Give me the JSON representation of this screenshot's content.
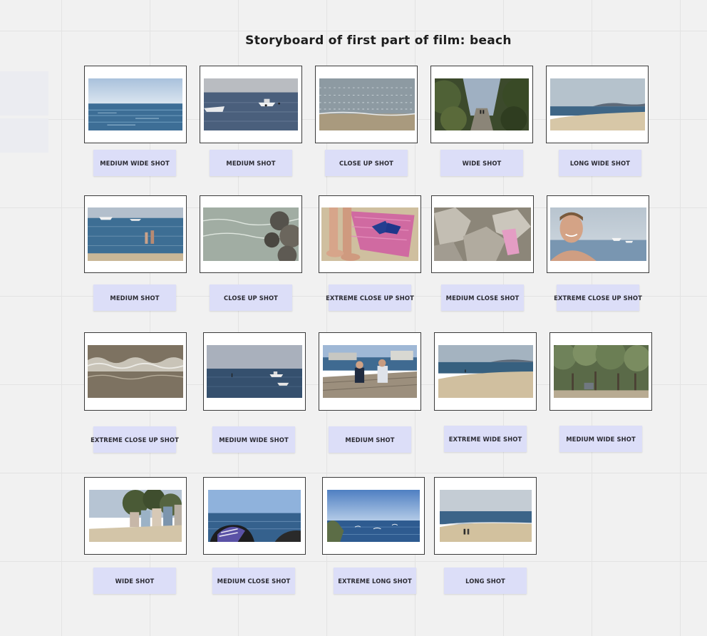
{
  "board": {
    "title": "Storyboard of first part of film: beach"
  },
  "shots": [
    {
      "label": "MEDIUM WIDE SHOT",
      "scene": "open-sea"
    },
    {
      "label": "MEDIUM SHOT",
      "scene": "boats-on-sea"
    },
    {
      "label": "CLOSE UP SHOT",
      "scene": "shallow-water"
    },
    {
      "label": "WIDE SHOT",
      "scene": "bush-path"
    },
    {
      "label": "LONG WIDE SHOT",
      "scene": "beach-headland"
    },
    {
      "label": "MEDIUM SHOT",
      "scene": "people-wading"
    },
    {
      "label": "CLOSE UP SHOT",
      "scene": "water-and-rocks"
    },
    {
      "label": "EXTREME CLOSE UP SHOT",
      "scene": "feet-and-towel"
    },
    {
      "label": "MEDIUM CLOSE SHOT",
      "scene": "towel-on-rocks"
    },
    {
      "label": "EXTREME CLOSE UP SHOT",
      "scene": "smiling-swimmer"
    },
    {
      "label": "EXTREME CLOSE UP SHOT",
      "scene": "wave-foam"
    },
    {
      "label": "MEDIUM WIDE SHOT",
      "scene": "calm-sea-boat"
    },
    {
      "label": "MEDIUM SHOT",
      "scene": "men-on-pier"
    },
    {
      "label": "EXTREME WIDE SHOT",
      "scene": "beach-and-bay"
    },
    {
      "label": "MEDIUM WIDE SHOT",
      "scene": "tea-trees"
    },
    {
      "label": "WIDE SHOT",
      "scene": "bathing-boxes"
    },
    {
      "label": "MEDIUM CLOSE SHOT",
      "scene": "towel-on-rock-by-sea"
    },
    {
      "label": "EXTREME LONG SHOT",
      "scene": "rocky-shoreline"
    },
    {
      "label": "LONG SHOT",
      "scene": "two-figures-on-beach"
    }
  ],
  "colors": {
    "canvas": "#f1f1f1",
    "grid": "#e3e3e3",
    "label_bg": "#dcdef8",
    "frame_border": "#3a3a3a"
  }
}
